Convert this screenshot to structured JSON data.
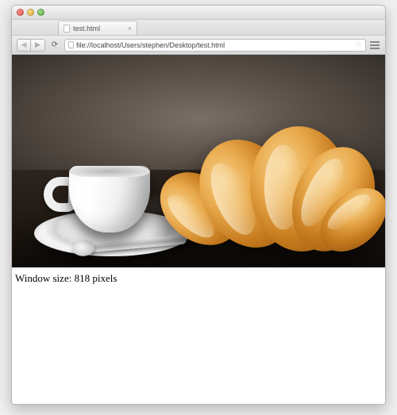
{
  "browser": {
    "tab": {
      "title": "test.html"
    },
    "address": "file://localhost/Users/stephen/Desktop/test.html"
  },
  "page": {
    "status_prefix": "Window size: ",
    "window_size_px": 818,
    "status_suffix": " pixels"
  }
}
